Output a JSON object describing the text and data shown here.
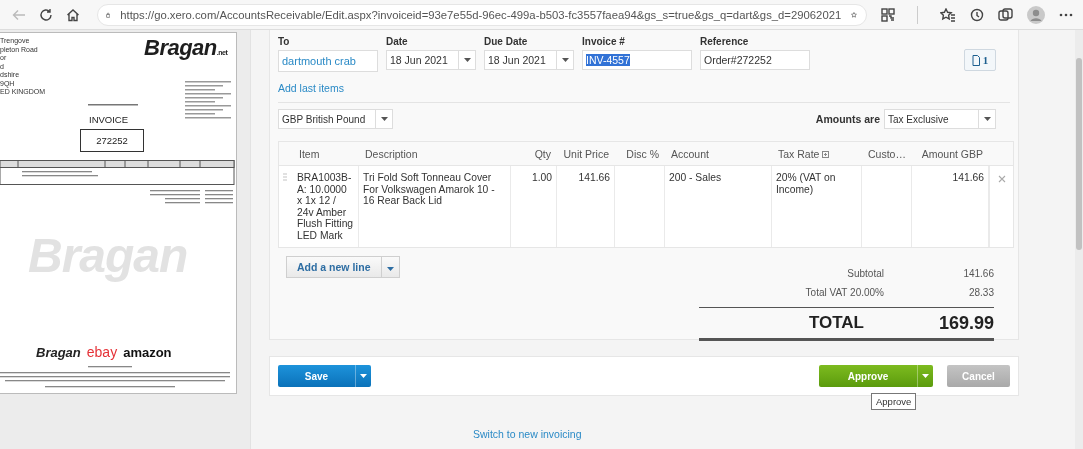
{
  "browser": {
    "url": "https://go.xero.com/AccountsReceivable/Edit.aspx?invoiceid=93e7e55d-96ec-499a-b503-fc3557faea94&gs_s=true&gs_q=dart&gs_d=29062021"
  },
  "document_preview": {
    "address_lines": [
      "Trengove",
      "pleton Road",
      "or",
      "d",
      "dshire",
      "9QH",
      "ED KINGDOM"
    ],
    "logo": "Bragan",
    "logo_suffix": ".net",
    "title": "INVOICE",
    "number": "272252",
    "watermark": "Bragan",
    "footer_logos": [
      "Bragan",
      "ebay",
      "amazon"
    ]
  },
  "invoice": {
    "fields": [
      {
        "label": "To",
        "value": "dartmouth crab",
        "kind": "contact",
        "selected": false
      },
      {
        "label": "Date",
        "value": "18 Jun 2021",
        "kind": "date",
        "selected": false
      },
      {
        "label": "Due Date",
        "value": "18 Jun 2021",
        "kind": "date",
        "selected": false
      },
      {
        "label": "Invoice #",
        "value": "INV-4557",
        "kind": "text",
        "selected": true
      },
      {
        "label": "Reference",
        "value": "Order#272252",
        "kind": "text",
        "selected": false
      }
    ],
    "attachments_count": "1",
    "add_last_items": "Add last items",
    "currency": "GBP British Pound",
    "amounts_are_label": "Amounts are",
    "amounts_are": "Tax Exclusive",
    "columns": [
      "Item",
      "Description",
      "Qty",
      "Unit Price",
      "Disc %",
      "Account",
      "Tax Rate",
      "Custo…",
      "Amount GBP"
    ],
    "rows": [
      {
        "item": "BRA1003B-A: 10.0000 x 1x 12 / 24v Amber Flush Fitting LED Mark",
        "description": "Tri Fold Soft Tonneau Cover For Volkswagen Amarok 10 - 16 Rear Back Lid",
        "qty": "1.00",
        "unit_price": "141.66",
        "account": "200 - Sales",
        "tax_rate": "20% (VAT on Income)",
        "amount": "141.66"
      }
    ],
    "add_line": "Add a new line",
    "totals": [
      {
        "label": "Subtotal",
        "value": "141.66"
      },
      {
        "label": "Total VAT 20.00%",
        "value": "28.33"
      }
    ],
    "total": {
      "label": "TOTAL",
      "value": "169.99"
    },
    "buttons": [
      {
        "label": "Save",
        "kind": "primary"
      },
      {
        "label": "Approve",
        "kind": "success"
      },
      {
        "label": "Cancel",
        "kind": "neutral"
      }
    ],
    "tooltip": "Approve",
    "switch_link": "Switch to new invoicing"
  }
}
